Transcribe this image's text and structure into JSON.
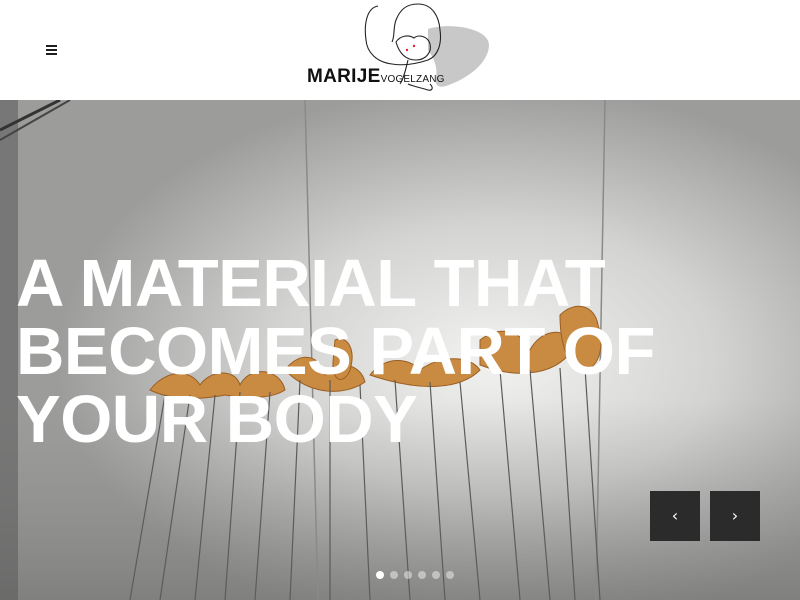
{
  "header": {
    "menu_icon": "hamburger-menu-icon",
    "logo": {
      "name_main": "MARIJE",
      "name_sub": "VOGELZANG"
    }
  },
  "hero": {
    "title_lines": [
      "A MATERIAL THAT",
      "BECOMES PART OF",
      "YOUR BODY"
    ],
    "prev_label": "‹",
    "next_label": "›",
    "slide_count": 6,
    "active_slide": 1
  },
  "colors": {
    "header_bg": "#ffffff",
    "nav_button_bg": "#2b2b2b",
    "title_color": "#ffffff",
    "wall": "#bdbcb9",
    "bread": "#c98a42"
  }
}
